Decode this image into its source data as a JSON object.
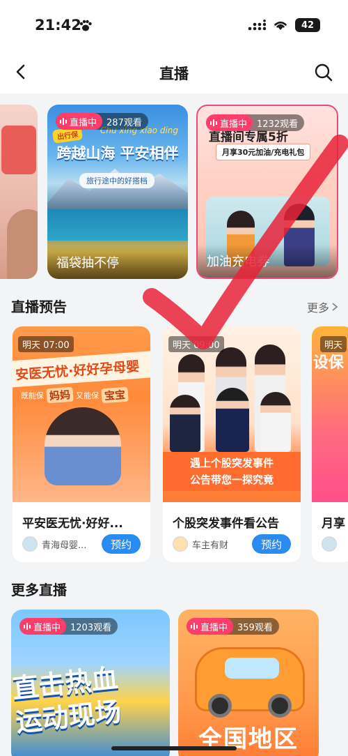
{
  "status_bar": {
    "time": "21:42",
    "battery": "42"
  },
  "nav": {
    "title": "直播"
  },
  "top_live": [
    {
      "badge": "直播中",
      "viewers": "287观看",
      "headline": "跨越山海 平安相伴",
      "sub": "旅行途中的好搭档",
      "tag": "出行保",
      "pinyin": "Chu xing xiao ding",
      "caption": "福袋抽不停"
    },
    {
      "badge": "直播中",
      "viewers": "1232观看",
      "headline": "直播间专属5折",
      "sub": "月享30元加油/充电礼包",
      "caption": "加油充电券"
    }
  ],
  "preview": {
    "title": "直播预告",
    "more": "更多",
    "cards": [
      {
        "time": "明天 07:00",
        "banner": "安医无忧·好好孕母婴",
        "sub_a": "既能保",
        "chip_a": "妈妈",
        "sub_b": "又能保",
        "chip_b": "宝宝",
        "title": "平安医无忧·好好...",
        "host": "青海母婴...",
        "button": "预约"
      },
      {
        "time": "明天 09:00",
        "caption": "遇上个股突发事件\n公告带您一探究竟",
        "title": "个股突发事件看公告",
        "host": "车主有财",
        "button": "预约"
      },
      {
        "time": "明天",
        "head": "设保",
        "title": "月享"
      }
    ]
  },
  "more_live": {
    "title": "更多直播",
    "cards": [
      {
        "badge": "直播中",
        "viewers": "1203观看",
        "headline": "直击热血\n运动现场"
      },
      {
        "badge": "直播中",
        "viewers": "359观看",
        "headline": "全国地区"
      }
    ]
  },
  "colors": {
    "live_pink": "#ff3d6a",
    "reserve_blue": "#2a8cf0",
    "check_red": "#e8233a"
  }
}
